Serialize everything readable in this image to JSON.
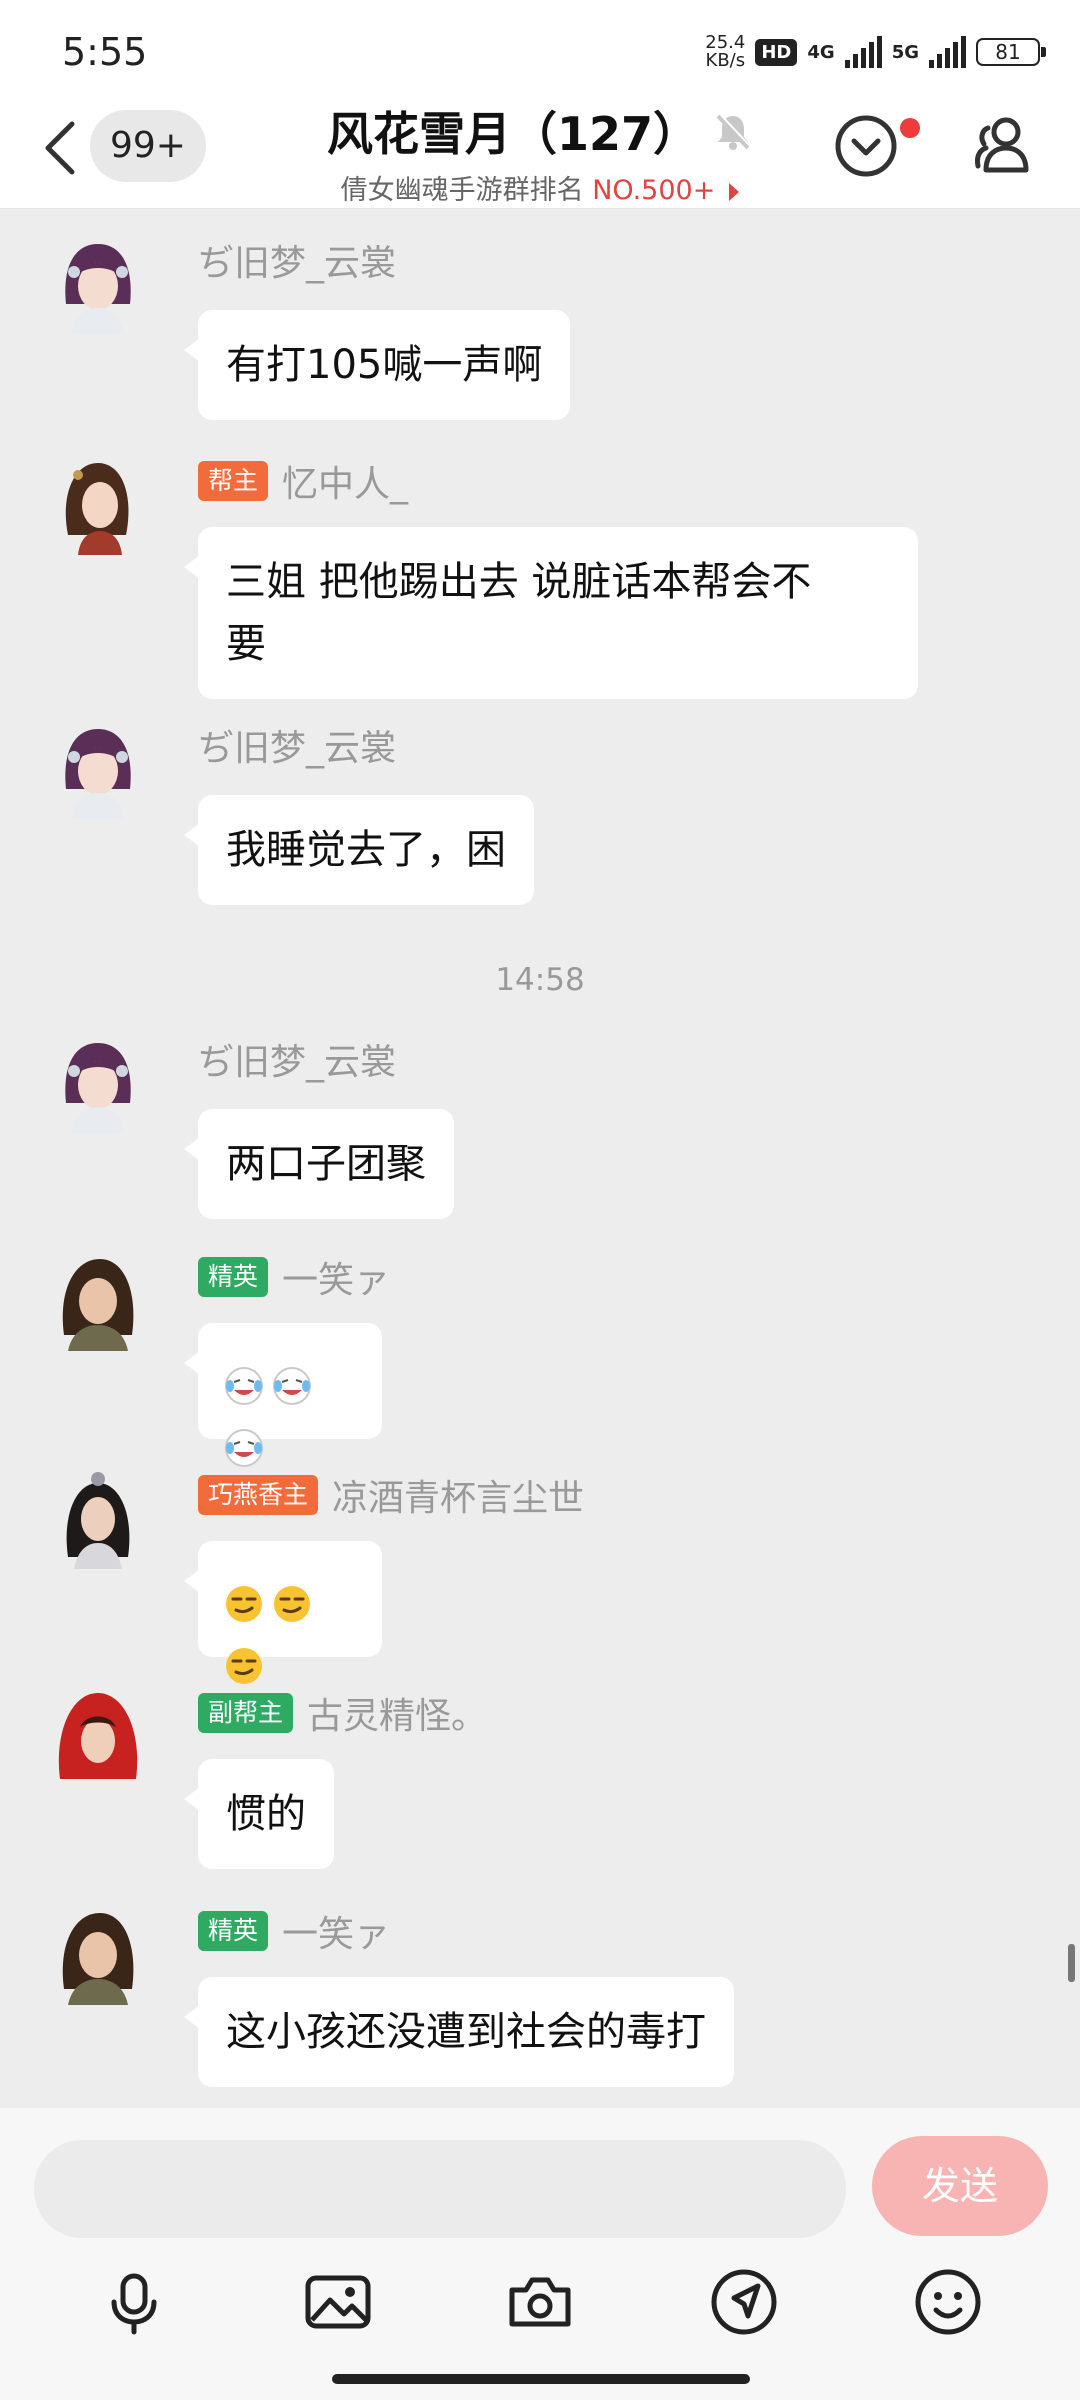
{
  "status_bar": {
    "time": "5:55",
    "net_speed_value": "25.4",
    "net_speed_unit": "KB/s",
    "hd_badge": "HD",
    "sim1_label": "4G",
    "sim2_label": "5G",
    "battery": "81"
  },
  "header": {
    "unread_count": "99+",
    "group_title": "风花雪月（127）",
    "subtitle_prefix": "倩女幽魂手游群排名 ",
    "subtitle_rank": "NO.500+"
  },
  "messages": [
    {
      "name": "ぢ旧梦_云裳",
      "tag": "",
      "text": "有打105喊一声啊",
      "avatar": "avatar-ghost-woman"
    },
    {
      "name": "忆中人_",
      "tag": "帮主",
      "tag_color": "#f26b3a",
      "text": "三姐 把他踢出去 说脏话本帮会不要",
      "text_line1": "三姐 把他踢出去 说脏话本帮会不",
      "text_line2": "要",
      "avatar": "avatar-brown-hair"
    },
    {
      "name": "ぢ旧梦_云裳",
      "tag": "",
      "text": "我睡觉去了，困",
      "avatar": "avatar-ghost-woman"
    },
    {
      "name": "ぢ旧梦_云裳",
      "tag": "",
      "text": "两口子团聚",
      "avatar": "avatar-ghost-woman"
    },
    {
      "name": "一笑ァ",
      "tag": "精英",
      "tag_color": "#2eaa62",
      "text": "",
      "emoji": "laughing-crying-emoji",
      "avatar": "avatar-warrior"
    },
    {
      "name": "凉酒青杯言尘世",
      "tag": "巧燕香主",
      "tag_color": "#f26b3a",
      "text": "",
      "emoji": "smirk-emoji",
      "avatar": "avatar-swordsman"
    },
    {
      "name": "古灵精怪。",
      "tag": "副帮主",
      "tag_color": "#2eaa62",
      "text": "惯的",
      "avatar": "avatar-red-hood"
    },
    {
      "name": "一笑ァ",
      "tag": "精英",
      "tag_color": "#2eaa62",
      "text": "这小孩还没遭到社会的毒打",
      "avatar": "avatar-warrior"
    }
  ],
  "timestamp": "14:58",
  "input": {
    "placeholder": "",
    "send_label": "发送"
  },
  "toolbar": [
    "microphone-icon",
    "image-icon",
    "camera-icon",
    "location-icon",
    "emoji-icon"
  ],
  "colors": {
    "accent": "#e34242",
    "tag_orange": "#f26b3a",
    "tag_green": "#2eaa62",
    "send_disabled": "#f8b3b3",
    "chat_background": "#ededed"
  }
}
